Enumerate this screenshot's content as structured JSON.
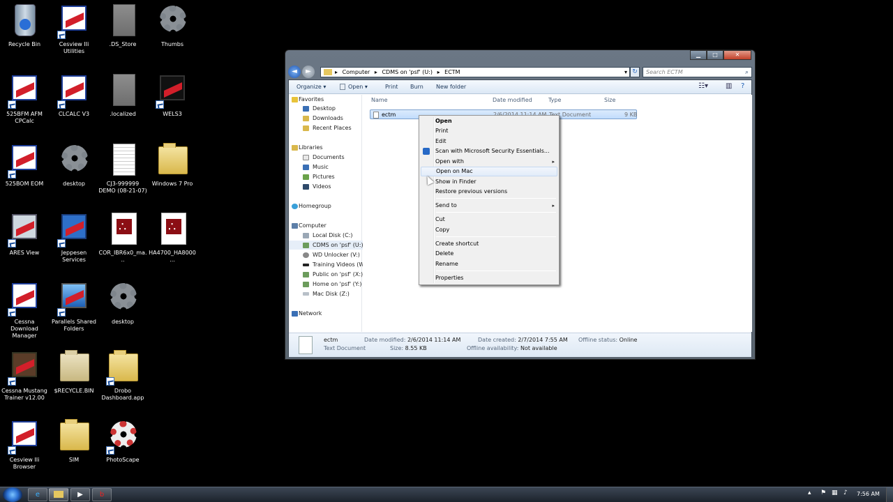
{
  "desktop": {
    "icons": [
      {
        "label": "Recycle Bin"
      },
      {
        "label": "Cesview IIi Utilities"
      },
      {
        "label": ".DS_Store"
      },
      {
        "label": "Thumbs"
      },
      {
        "label": "525BFM AFM CPCalc"
      },
      {
        "label": "CLCALC V3"
      },
      {
        "label": ".localized"
      },
      {
        "label": "WELS3"
      },
      {
        "label": "525BOM EOM"
      },
      {
        "label": "desktop"
      },
      {
        "label": "CJ3-999999 DEMO (08-21-07)"
      },
      {
        "label": "Windows 7 Pro"
      },
      {
        "label": "ARES View"
      },
      {
        "label": "Jeppesen Services"
      },
      {
        "label": "COR_IBR6x0_ma..."
      },
      {
        "label": "HA4700_HA8000..."
      },
      {
        "label": "Cessna Download Manager"
      },
      {
        "label": "Parallels Shared Folders"
      },
      {
        "label": "desktop"
      },
      {
        "label": "Cessna Mustang Trainer v12.00"
      },
      {
        "label": "$RECYCLE.BIN"
      },
      {
        "label": "Drobo Dashboard.app"
      },
      {
        "label": "Cesview IIi Browser"
      },
      {
        "label": "SIM"
      },
      {
        "label": "PhotoScape"
      }
    ]
  },
  "window": {
    "address": {
      "segments": [
        "Computer",
        "CDMS on 'psf' (U:)",
        "ECTM"
      ],
      "sep": "▸",
      "dropdown": "▾"
    },
    "search_placeholder": "Search ECTM",
    "search_icon": "magnifier-icon",
    "toolbar": {
      "organize": "Organize ▾",
      "open": "Open ▾",
      "print": "Print",
      "burn": "Burn",
      "new_folder": "New folder"
    },
    "nav": {
      "favorites": "Favorites",
      "desktop": "Desktop",
      "downloads": "Downloads",
      "recent": "Recent Places",
      "libraries": "Libraries",
      "documents": "Documents",
      "music": "Music",
      "pictures": "Pictures",
      "videos": "Videos",
      "homegroup": "Homegroup",
      "computer": "Computer",
      "local_disk": "Local Disk (C:)",
      "cdms": "CDMS on 'psf' (U:)",
      "wd": "WD Unlocker (V:)",
      "training": "Training Videos (W:)",
      "public": "Public on 'psf' (X:)",
      "home": "Home on 'psf' (Y:)",
      "mac": "Mac Disk (Z:)",
      "network": "Network"
    },
    "columns": {
      "name": "Name",
      "date": "Date modified",
      "type": "Type",
      "size": "Size"
    },
    "file": {
      "name": "ectm",
      "date": "2/6/2014 11:14 AM",
      "type": "Text Document",
      "size": "9 KB"
    },
    "details": {
      "name": "ectm",
      "kind": "Text Document",
      "date_modified_label": "Date modified:",
      "date_modified": "2/6/2014 11:14 AM",
      "size_label": "Size:",
      "size": "8.55 KB",
      "date_created_label": "Date created:",
      "date_created": "2/7/2014 7:55 AM",
      "offline_avail_label": "Offline availability:",
      "offline_avail": "Not available",
      "offline_status_label": "Offline status:",
      "offline_status": "Online"
    }
  },
  "context_menu": {
    "open": "Open",
    "print": "Print",
    "edit": "Edit",
    "scan": "Scan with Microsoft Security Essentials...",
    "open_with": "Open with",
    "open_on_mac": "Open on Mac",
    "show_in_finder": "Show in Finder",
    "restore": "Restore previous versions",
    "send_to": "Send to",
    "cut": "Cut",
    "copy": "Copy",
    "create_shortcut": "Create shortcut",
    "delete": "Delete",
    "rename": "Rename",
    "properties": "Properties",
    "submenu_arrow": "▸"
  },
  "taskbar": {
    "clock": "7:56 AM"
  }
}
